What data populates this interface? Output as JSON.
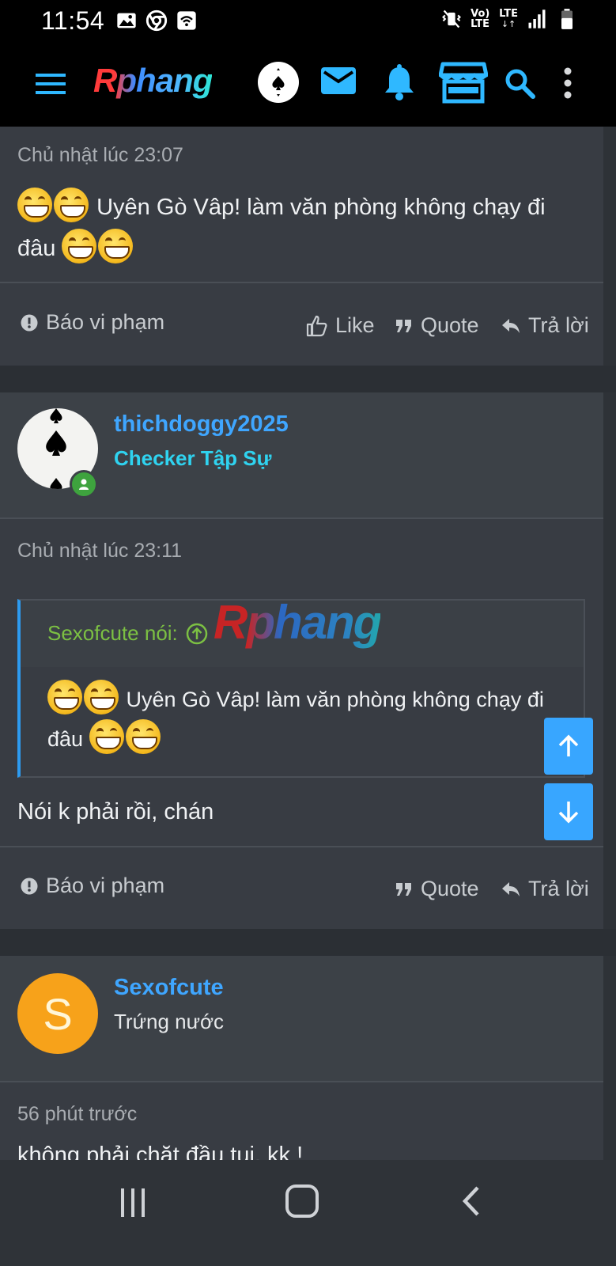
{
  "status_bar": {
    "time": "11:54",
    "volte": "Vo)\nLTE",
    "lte": "LTE"
  },
  "app_bar": {
    "logo": "Rphang"
  },
  "post1": {
    "timestamp": "Chủ nhật lúc 23:07",
    "text": "Uyên Gò Vâp! làm văn phòng không chạy đi",
    "text_line2": "đâu",
    "report": "Báo vi phạm",
    "like": "Like",
    "quote": "Quote",
    "reply": "Trả lời"
  },
  "post2": {
    "username": "thichdoggy2025",
    "user_title": "Checker Tập Sự",
    "user_title_color": "#2fd3f0",
    "timestamp": "Chủ nhật lúc 23:11",
    "quote_author": "Sexofcute nói:",
    "quote_text": "Uyên Gò Vâp! làm văn phòng không chạy đi",
    "quote_text_line2": "đâu",
    "text": "Nói k phải rồi, chán",
    "report": "Báo vi phạm",
    "quote": "Quote",
    "reply": "Trả lời",
    "watermark": "Rphang"
  },
  "post3": {
    "avatar_letter": "S",
    "avatar_color": "#f7a21a",
    "username": "Sexofcute",
    "user_title": "Trứng nước",
    "timestamp": "56 phút trước",
    "text_clipped": "không phải chặt đầu tui. kk !"
  },
  "colors": {
    "accent": "#3fa6ff",
    "icon_blue": "#2fb8ff",
    "green": "#7cc043"
  }
}
